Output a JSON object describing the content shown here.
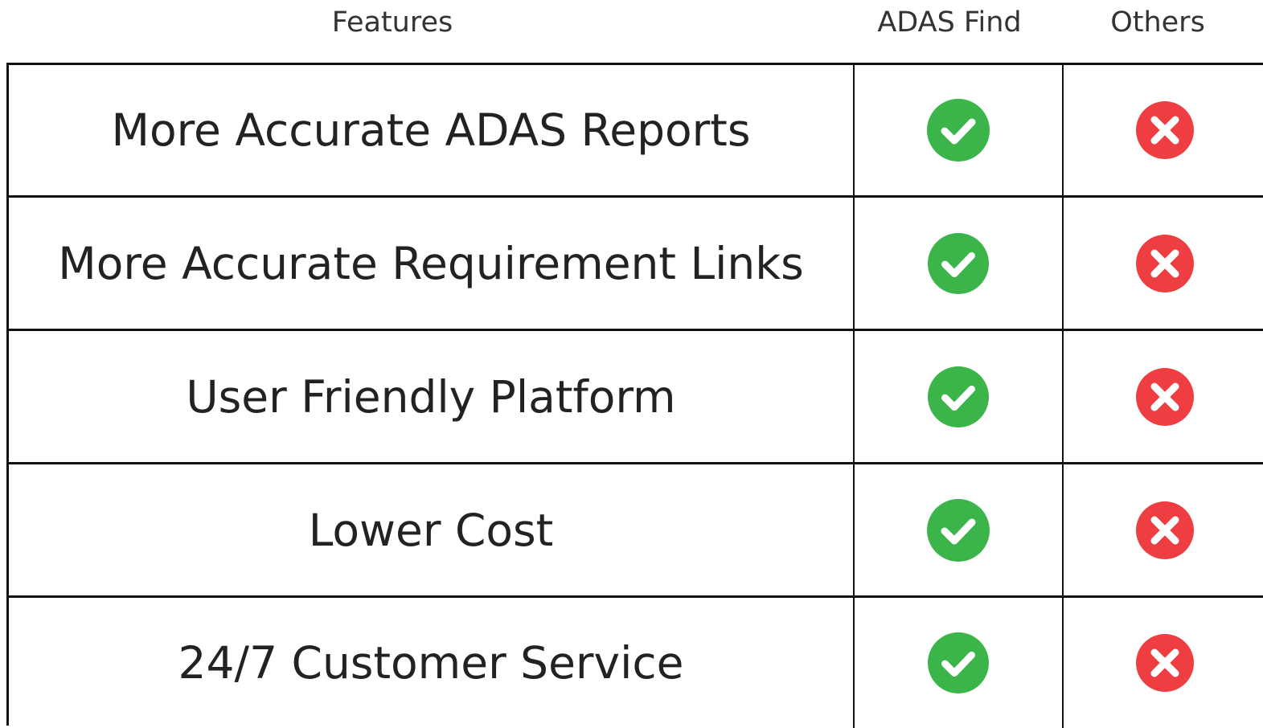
{
  "header": {
    "features_label": "Features",
    "adas_label": "ADAS Find",
    "others_label": "Others"
  },
  "rows": [
    {
      "feature": "More Accurate ADAS Reports",
      "adas_find": "check-icon",
      "others": "x-icon"
    },
    {
      "feature": "More Accurate Requirement Links",
      "adas_find": "check-icon",
      "others": "x-icon"
    },
    {
      "feature": "User Friendly Platform",
      "adas_find": "check-icon",
      "others": "x-icon"
    },
    {
      "feature": "Lower Cost",
      "adas_find": "check-icon",
      "others": "x-icon"
    },
    {
      "feature": "24/7 Customer Service",
      "adas_find": "check-icon",
      "others": "x-icon"
    }
  ],
  "colors": {
    "check": "#3bb54a",
    "cross": "#ef3e42",
    "border": "#111111",
    "text": "#222222"
  }
}
